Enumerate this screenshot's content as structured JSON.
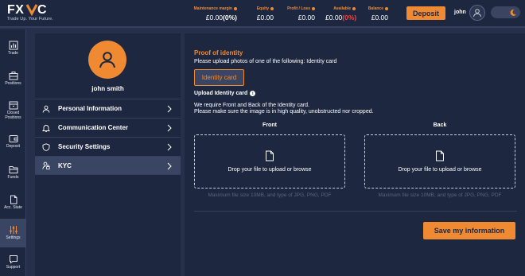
{
  "brand": {
    "name": "FXVC",
    "tagline": "Trade Up. Your Future."
  },
  "header": {
    "metrics": [
      {
        "label": "Maintenance margin",
        "value": "£0.00",
        "pct": "(0%)"
      },
      {
        "label": "Equity",
        "value": "£0.00"
      },
      {
        "label": "Profit / Loss",
        "value": "£0.00"
      },
      {
        "label": "Available",
        "value": "£0.00",
        "pct": "(0%)"
      },
      {
        "label": "Balance",
        "value": "£0.00"
      }
    ],
    "deposit_label": "Deposit",
    "username": "john"
  },
  "nav": {
    "items": [
      {
        "label": "Trade",
        "icon": "chart-icon"
      },
      {
        "label": "Positions",
        "icon": "briefcase-icon"
      },
      {
        "label": "Closed Positions",
        "icon": "archive-icon"
      },
      {
        "label": "Deposit",
        "icon": "wallet-icon"
      },
      {
        "label": "Funds",
        "icon": "folder-icon"
      },
      {
        "label": "Acc. State",
        "icon": "document-icon"
      },
      {
        "label": "Settings",
        "icon": "sliders-icon",
        "active": true
      },
      {
        "label": "Support",
        "icon": "chat-icon"
      }
    ]
  },
  "profile": {
    "full_name": "john smith",
    "menu": [
      {
        "label": "Personal Information",
        "icon": "user-icon"
      },
      {
        "label": "Communication Center",
        "icon": "bell-icon"
      },
      {
        "label": "Security Settings",
        "icon": "shield-icon"
      },
      {
        "label": "KYC",
        "icon": "user-lock-icon",
        "active": true
      }
    ]
  },
  "kyc": {
    "title": "Proof of identity",
    "subtitle": "Please upload photos of one of the following: Identity card",
    "doc_type_button": "Identity card",
    "upload_title": "Upload Identity card",
    "note_line1": "We require Front and Back of the Identity card.",
    "note_line2": "Please make sure the image is in high quality, unobstructed nor cropped.",
    "front_label": "Front",
    "back_label": "Back",
    "dropzone_text": "Drop your file to upload or browse",
    "limit_text": "Maximum file size 10MB, and type of JPG, PNG, PDF",
    "save_label": "Save my information"
  },
  "colors": {
    "accent": "#ef8a33",
    "panel": "#1e2740",
    "background": "#26304a",
    "negative": "#e84a4a"
  }
}
